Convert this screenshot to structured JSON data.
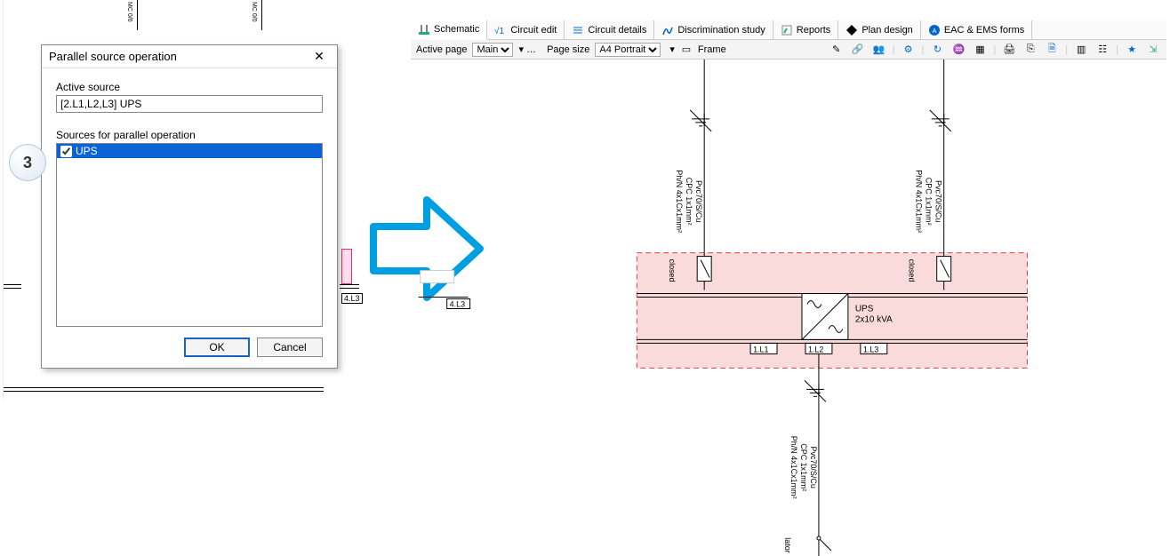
{
  "step_badge": "3",
  "dialog": {
    "title": "Parallel source operation",
    "close_glyph": "✕",
    "active_label": "Active source",
    "active_value": "[2.L1,L2,L3] UPS",
    "list_label": "Sources for parallel operation",
    "items": [
      {
        "label": "UPS",
        "checked": true
      }
    ],
    "ok": "OK",
    "cancel": "Cancel"
  },
  "bg": {
    "tag1": "MC\n0/0",
    "tag2": "MC\n0/0",
    "node": "4.L3"
  },
  "ribbon": {
    "tabs": [
      {
        "label": "Schematic",
        "icon": "schematic-icon",
        "active": true
      },
      {
        "label": "Circuit edit",
        "icon": "circuit-edit-icon"
      },
      {
        "label": "Circuit details",
        "icon": "circuit-details-icon"
      },
      {
        "label": "Discrimination study",
        "icon": "discrimination-icon"
      },
      {
        "label": "Reports",
        "icon": "reports-icon"
      },
      {
        "label": "Plan design",
        "icon": "plan-icon"
      },
      {
        "label": "EAC & EMS forms",
        "icon": "eac-icon"
      }
    ]
  },
  "optbar": {
    "active_page_label": "Active page",
    "active_page_value": "Main",
    "page_size_label": "Page size",
    "page_size_value": "A4 Portrait",
    "frame_label": "Frame"
  },
  "schematic": {
    "cable_lines": [
      "Ph/N 4x1Cx1mm²",
      "CPC  1x1mm²",
      "Pvc70/S/Cu"
    ],
    "breaker_state": "closed",
    "ups_name": "UPS",
    "ups_rating": "2x10 kVA",
    "nodes": [
      "1.L1",
      "1.L2",
      "1.L3"
    ],
    "bottom_tag": "lator"
  },
  "icons": {
    "pencil": "✎",
    "link": "🔗",
    "users": "👥",
    "sliders": "⚙",
    "refresh": "↻",
    "tree": "♒",
    "grid": "▦",
    "print": "🖨",
    "copy": "⎘",
    "doc": "🗎",
    "hbar": "▥",
    "forms": "☷",
    "star": "★",
    "export": "⇲"
  }
}
